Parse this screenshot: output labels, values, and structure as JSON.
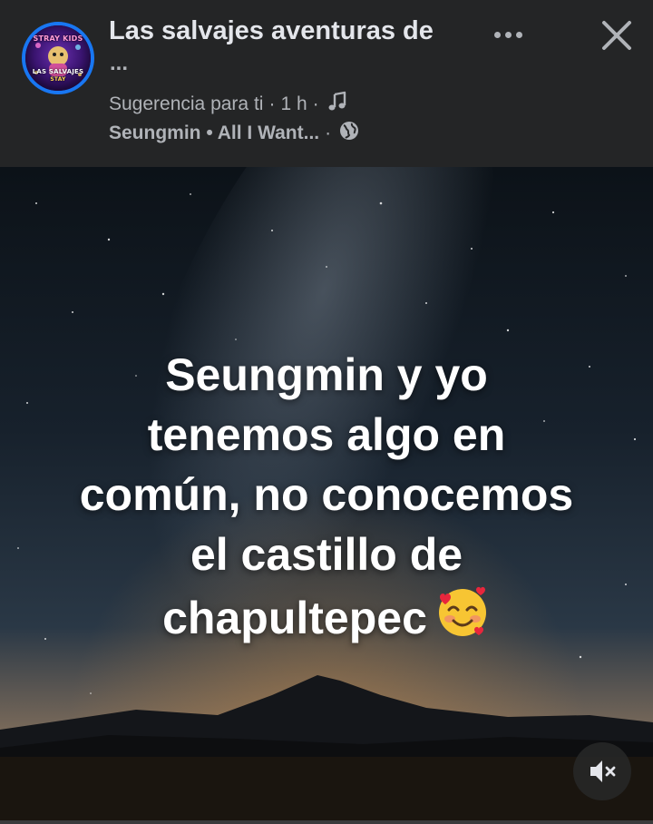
{
  "header": {
    "page_name": "Las salvajes aventuras de",
    "page_name_overflow": "...",
    "avatar_lines": [
      "STRAY KIDS",
      "LAS SALVAJES",
      "STAY"
    ],
    "suggestion": "Sugerencia para ti",
    "time": "1 h",
    "separator": "·",
    "song": "Seungmin • All I Want...",
    "icons": {
      "music": "music-note-icon",
      "audience": "globe-icon",
      "more": "more-options-icon",
      "close": "close-icon"
    }
  },
  "post": {
    "lines": [
      "Seungmin y yo",
      "tenemos algo en",
      "común, no conocemos",
      "el castillo de",
      "chapultepec"
    ],
    "emoji": "🥰",
    "mute_icon": "speaker-muted-icon"
  },
  "colors": {
    "header_bg": "#242526",
    "title_text": "#e4e6eb",
    "meta_text": "#b0b3b8",
    "avatar_ring": "#1877f2"
  }
}
